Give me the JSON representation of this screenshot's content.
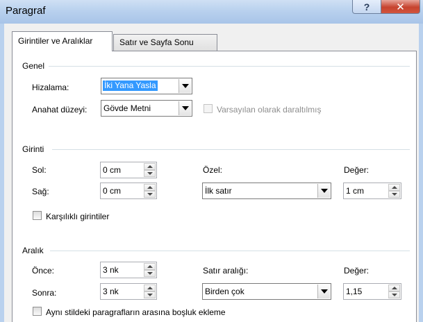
{
  "window": {
    "title": "Paragraf",
    "help_glyph": "?",
    "close_glyph": "✕"
  },
  "tabs": [
    {
      "label": "Girintiler ve Aralıklar",
      "active": true
    },
    {
      "label": "Satır ve Sayfa Sonu",
      "active": false
    }
  ],
  "genel": {
    "title": "Genel",
    "alignment_label": "Hizalama:",
    "alignment_value": "İki Yana Yasla",
    "outline_label": "Anahat düzeyi:",
    "outline_value": "Gövde Metni",
    "collapsed_label": "Varsayılan olarak daraltılmış"
  },
  "girinti": {
    "title": "Girinti",
    "left_label": "Sol:",
    "left_value": "0 cm",
    "right_label": "Sağ:",
    "right_value": "0 cm",
    "special_label": "Özel:",
    "special_value": "İlk satır",
    "by_label": "Değer:",
    "by_value": "1 cm",
    "mirror_label": "Karşılıklı girintiler"
  },
  "aralik": {
    "title": "Aralık",
    "before_label": "Önce:",
    "before_value": "3 nk",
    "after_label": "Sonra:",
    "after_value": "3 nk",
    "line_spacing_label": "Satır aralığı:",
    "line_spacing_value": "Birden çok",
    "at_label": "Değer:",
    "at_value": "1,15",
    "no_space_label": "Aynı stildeki paragrafların arasına boşluk ekleme"
  }
}
